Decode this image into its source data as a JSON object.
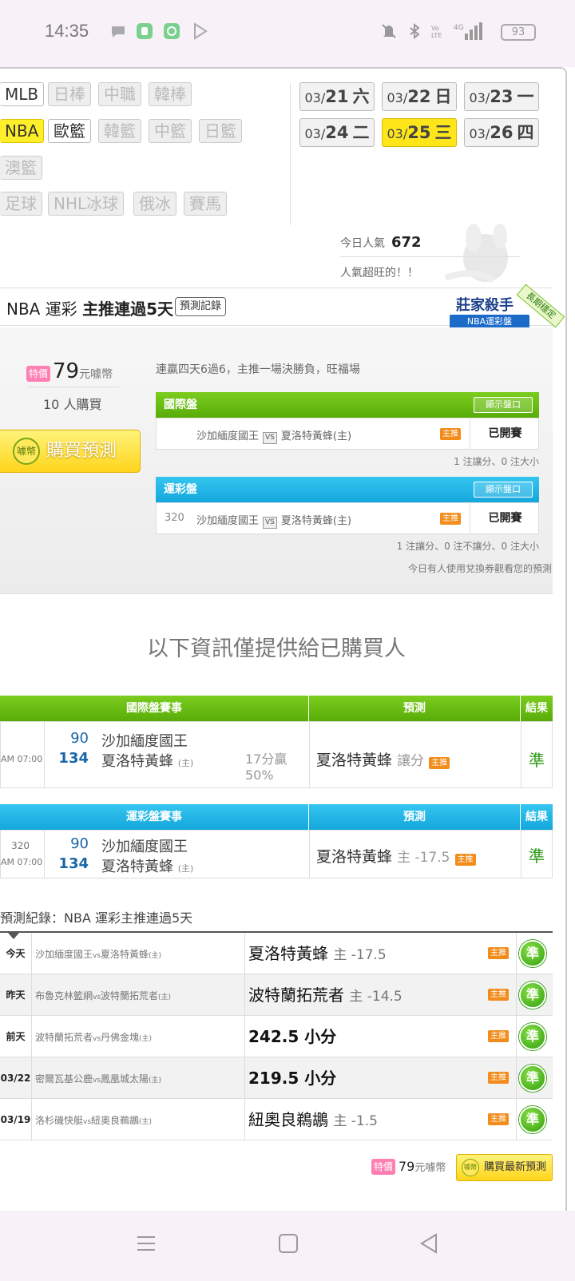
{
  "status": {
    "time": "14:35",
    "battery": "93",
    "network": "4G"
  },
  "sports": {
    "row1": [
      "MLB",
      "日棒",
      "中職",
      "韓棒"
    ],
    "row2": [
      "NBA",
      "歐籃",
      "韓籃",
      "中籃",
      "日籃"
    ],
    "row3": [
      "澳籃"
    ],
    "row4": [
      "足球",
      "NHL冰球",
      "俄冰",
      "賽馬"
    ]
  },
  "dates": [
    {
      "md": "03/",
      "d": "21",
      "wd": "六"
    },
    {
      "md": "03/",
      "d": "22",
      "wd": "日"
    },
    {
      "md": "03/",
      "d": "23",
      "wd": "一"
    },
    {
      "md": "03/",
      "d": "24",
      "wd": "二"
    },
    {
      "md": "03/",
      "d": "25",
      "wd": "三"
    },
    {
      "md": "03/",
      "d": "26",
      "wd": "四"
    }
  ],
  "popularity": {
    "label": "今日人氣",
    "value": "672",
    "note": "人氣超旺的！！"
  },
  "section": {
    "title_prefix": "NBA 運彩 ",
    "title_bold": "主推連過5天",
    "record_button": "預測記錄",
    "badge_main": "莊家殺手",
    "badge_sub": "NBA運彩盤",
    "badge_ribbon": "長期穩定"
  },
  "offer": {
    "special": "特價",
    "price": "79",
    "currency": "元噱幣",
    "buyers_num": "10",
    "buyers_label": "人購買",
    "buy_button": "購買預測",
    "coin": "噱幣",
    "desc": "連贏四天6過6，主推一場決勝負，旺福場"
  },
  "intl_panel": {
    "label": "國際盤",
    "show_button": "顯示盤口",
    "no": "",
    "home": "沙加緬度國王",
    "vs": "VS",
    "away": "夏洛特黃蜂(主)",
    "zhu": "主推",
    "status": "已開賽",
    "note": "1 注讓分、0 注大小"
  },
  "lottery_panel": {
    "label": "運彩盤",
    "show_button": "顯示盤口",
    "no": "320",
    "home": "沙加緬度國王",
    "vs": "VS",
    "away": "夏洛特黃蜂(主)",
    "zhu": "主推",
    "status": "已開賽",
    "note": "1 注讓分、0 注不讓分、0 注大小",
    "voucher_note": "今日有人使用兌換券觀看您的預測"
  },
  "info_title": "以下資訊僅提供給已購買人",
  "intl_table": {
    "headers": [
      "國際盤賽事",
      "預測",
      "結果"
    ],
    "time": "AM 07:00",
    "num1": "90",
    "team1": "沙加緬度國王",
    "num2": "134",
    "team2": "夏洛特黃蜂",
    "team2_tag": "(主)",
    "winrate1": "17分贏",
    "winrate2": "50%",
    "pick": "夏洛特黃蜂",
    "pick_type": "讓分",
    "zhu": "主推",
    "result": "準"
  },
  "lottery_table": {
    "headers": [
      "運彩盤賽事",
      "預測",
      "結果"
    ],
    "no": "320",
    "time": "AM 07:00",
    "num1": "90",
    "team1": "沙加緬度國王",
    "num2": "134",
    "team2": "夏洛特黃蜂",
    "team2_tag": "(主)",
    "pick": "夏洛特黃蜂",
    "pick_type": "主 -17.5",
    "zhu": "主推",
    "result": "準"
  },
  "records": {
    "title": "預測紀錄：NBA 運彩主推連過5天",
    "rows": [
      {
        "day": "今天",
        "a": "沙加緬度國王",
        "b": "夏洛特黃蜂",
        "tag": "(主)",
        "pick": "夏洛特黃蜂",
        "line": "主 -17.5",
        "zhu": "主推",
        "res": "準"
      },
      {
        "day": "昨天",
        "a": "布魯克林籃網",
        "b": "波特蘭拓荒者",
        "tag": "(主)",
        "pick": "波特蘭拓荒者",
        "line": "主 -14.5",
        "zhu": "主推",
        "res": "準"
      },
      {
        "day": "前天",
        "a": "波特蘭拓荒者",
        "b": "丹佛金塊",
        "tag": "(主)",
        "pick": "242.5 小分",
        "line": "",
        "zhu": "主推",
        "res": "準"
      },
      {
        "day": "03/22",
        "a": "密爾瓦基公鹿",
        "b": "鳳凰城太陽",
        "tag": "(主)",
        "pick": "219.5 小分",
        "line": "",
        "zhu": "主推",
        "res": "準"
      },
      {
        "day": "03/19",
        "a": "洛杉磯快艇",
        "b": "紐奧良鵜鶘",
        "tag": "(主)",
        "pick": "紐奧良鵜鶘",
        "line": "主 -1.5",
        "zhu": "主推",
        "res": "準"
      }
    ],
    "vs": "vs"
  },
  "bottom": {
    "special": "特價",
    "price": "79",
    "currency": "元噱幣",
    "button": "購買最新預測",
    "coin": "噱幣"
  },
  "colors": {
    "accent_yellow": "#ffe61b",
    "green": "#58ac08",
    "blue": "#13a7dc",
    "win": "#2f9f0b"
  }
}
